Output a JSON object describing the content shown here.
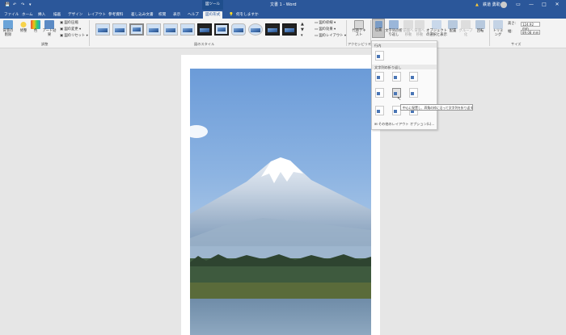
{
  "titlebar": {
    "context_tool": "図ツール",
    "doc_title": "文書 1 - Word",
    "user": "鉄道 勇助",
    "share": "共有",
    "warning_icon": "warning-icon",
    "minimize": "—",
    "restore": "□",
    "close": "✕"
  },
  "tabs": [
    {
      "label": "ファイル"
    },
    {
      "label": "ホーム"
    },
    {
      "label": "挿入"
    },
    {
      "label": "描画"
    },
    {
      "label": "デザイン"
    },
    {
      "label": "レイアウト"
    },
    {
      "label": "参考資料"
    },
    {
      "label": "差し込み文書"
    },
    {
      "label": "校閲"
    },
    {
      "label": "表示"
    },
    {
      "label": "ヘルプ"
    },
    {
      "label": "図の形式"
    },
    {
      "label": "何をしますか"
    }
  ],
  "ribbon": {
    "adjust": {
      "remove_bg": "背景の削除",
      "corrections": "修整",
      "color": "色",
      "artistic": "アート効果",
      "compress": "図の圧縮",
      "change": "図の変更",
      "reset": "図のリセット",
      "group_label": "調整"
    },
    "styles": {
      "group_label": "図のスタイル"
    },
    "picture_menu": {
      "border": "図の枠線",
      "effects": "図の効果",
      "layout": "図のレイアウト"
    },
    "accessibility": {
      "alt_text": "代替テキスト",
      "group_label": "アクセシビリティ"
    },
    "arrange": {
      "position": "位置",
      "wrap_text": "文字列の折り返し",
      "bring_forward": "前面へ移動",
      "send_backward": "背面へ移動",
      "selection_pane": "オブジェクトの選択と表示",
      "align": "配置",
      "group": "グループ化",
      "rotate": "回転"
    },
    "size": {
      "crop": "トリミング",
      "height_label": "高さ:",
      "height_value": "124.92 mm",
      "width_label": "幅:",
      "width_value": "89.08 mm",
      "group_label": "サイズ"
    }
  },
  "dropdown": {
    "section_inline": "行内",
    "section_wrap": "文字列の折り返し",
    "more_options": "その他のレイアウト オプション(L)...",
    "tooltip": "中心に配置し、四角の枠に沿って文字列を折り返す"
  }
}
